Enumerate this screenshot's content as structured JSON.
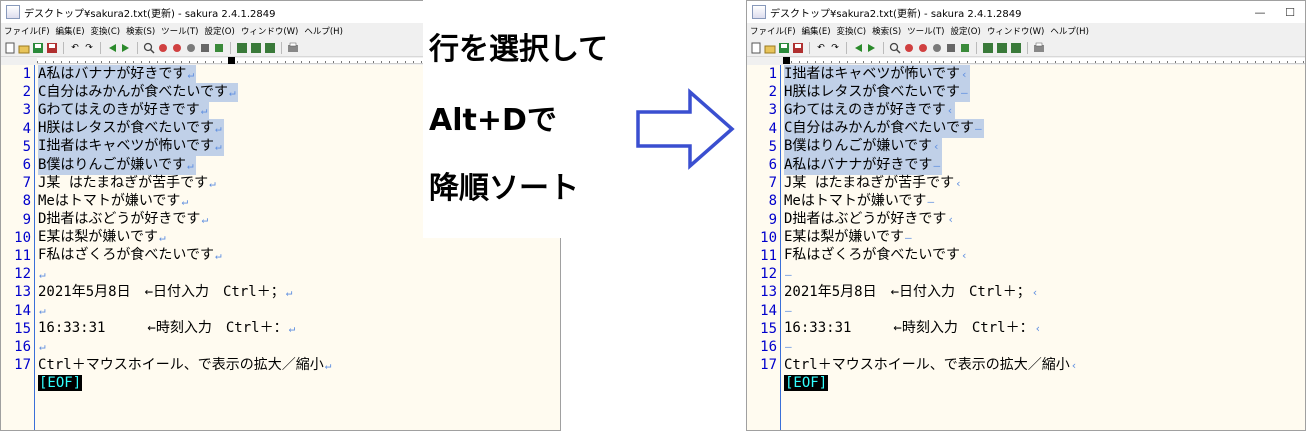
{
  "left_window": {
    "title": "デスクトップ¥sakura2.txt(更新) - sakura 2.4.1.2849",
    "menu": [
      "ファイル(F)",
      "編集(E)",
      "変換(C)",
      "検索(S)",
      "ツール(T)",
      "設定(O)",
      "ウィンドウ(W)",
      "ヘルプ(H)"
    ],
    "lines": [
      {
        "num": "1",
        "text": "A私はバナナが好きです",
        "eol": "↵"
      },
      {
        "num": "2",
        "text": "C自分はみかんが食べたいです",
        "eol": "↵"
      },
      {
        "num": "3",
        "text": "Gわてはえのきが好きです",
        "eol": "↵"
      },
      {
        "num": "4",
        "text": "H朕はレタスが食べたいです",
        "eol": "↵"
      },
      {
        "num": "5",
        "text": "I拙者はキャベツが怖いです",
        "eol": "↵"
      },
      {
        "num": "6",
        "text": "B僕はりんごが嫌いです",
        "eol": "↵"
      },
      {
        "num": "7",
        "text": "J某 はたまねぎが苦手です",
        "eol": "↵"
      },
      {
        "num": "8",
        "text": "Meはトマトが嫌いです",
        "eol": "↵"
      },
      {
        "num": "9",
        "text": "D拙者はぶどうが好きです",
        "eol": "↵"
      },
      {
        "num": "10",
        "text": "E某は梨が嫌いです",
        "eol": "↵"
      },
      {
        "num": "11",
        "text": "F私はざくろが食べたいです",
        "eol": "↵"
      },
      {
        "num": "12",
        "text": "",
        "eol": "↵"
      },
      {
        "num": "13",
        "text": "2021年5月8日　←日付入力　Ctrl＋；",
        "eol": "↵"
      },
      {
        "num": "14",
        "text": "",
        "eol": "↵"
      },
      {
        "num": "15",
        "text": "16:33:31　　　←時刻入力　Ctrl＋：",
        "eol": "↵"
      },
      {
        "num": "16",
        "text": "",
        "eol": "↵"
      },
      {
        "num": "17",
        "text": "Ctrl＋マウスホイール、で表示の拡大／縮小",
        "eol": "↵"
      }
    ],
    "eof": "[EOF]"
  },
  "right_window": {
    "title": "デスクトップ¥sakura2.txt(更新) - sakura 2.4.1.2849",
    "menu": [
      "ファイル(F)",
      "編集(E)",
      "変換(C)",
      "検索(S)",
      "ツール(T)",
      "設定(O)",
      "ウィンドウ(W)",
      "ヘルプ(H)"
    ],
    "lines": [
      {
        "num": "1",
        "text": "I拙者はキャベツが怖いです",
        "eol": "‹"
      },
      {
        "num": "2",
        "text": "H朕はレタスが食べたいです",
        "eol": "–"
      },
      {
        "num": "3",
        "text": "Gわてはえのきが好きです",
        "eol": "‹"
      },
      {
        "num": "4",
        "text": "C自分はみかんが食べたいです",
        "eol": "–"
      },
      {
        "num": "5",
        "text": "B僕はりんごが嫌いです",
        "eol": "‹"
      },
      {
        "num": "6",
        "text": "A私はバナナが好きです",
        "eol": "–"
      },
      {
        "num": "7",
        "text": "J某 はたまねぎが苦手です",
        "eol": "‹"
      },
      {
        "num": "8",
        "text": "Meはトマトが嫌いです",
        "eol": "–"
      },
      {
        "num": "9",
        "text": "D拙者はぶどうが好きです",
        "eol": "‹"
      },
      {
        "num": "10",
        "text": "E某は梨が嫌いです",
        "eol": "–"
      },
      {
        "num": "11",
        "text": "F私はざくろが食べたいです",
        "eol": "‹"
      },
      {
        "num": "12",
        "text": "",
        "eol": "–"
      },
      {
        "num": "13",
        "text": "2021年5月8日　←日付入力　Ctrl＋；",
        "eol": "‹"
      },
      {
        "num": "14",
        "text": "",
        "eol": "–"
      },
      {
        "num": "15",
        "text": "16:33:31　　　←時刻入力　Ctrl＋：",
        "eol": "‹"
      },
      {
        "num": "16",
        "text": "",
        "eol": "–"
      },
      {
        "num": "17",
        "text": "Ctrl＋マウスホイール、で表示の拡大／縮小",
        "eol": "‹"
      }
    ],
    "eof": "[EOF]"
  },
  "instructions": {
    "line1": "行を選択して",
    "line2": "Alt+Dで",
    "line3": "降順ソート"
  },
  "colors": {
    "line_number": "#0000cc",
    "selection": "#c0d0e8",
    "editor_bg": "#fffbf0",
    "arrow": "#3a4fd0"
  },
  "icons": {
    "arrow": "right-arrow-outline-icon"
  }
}
